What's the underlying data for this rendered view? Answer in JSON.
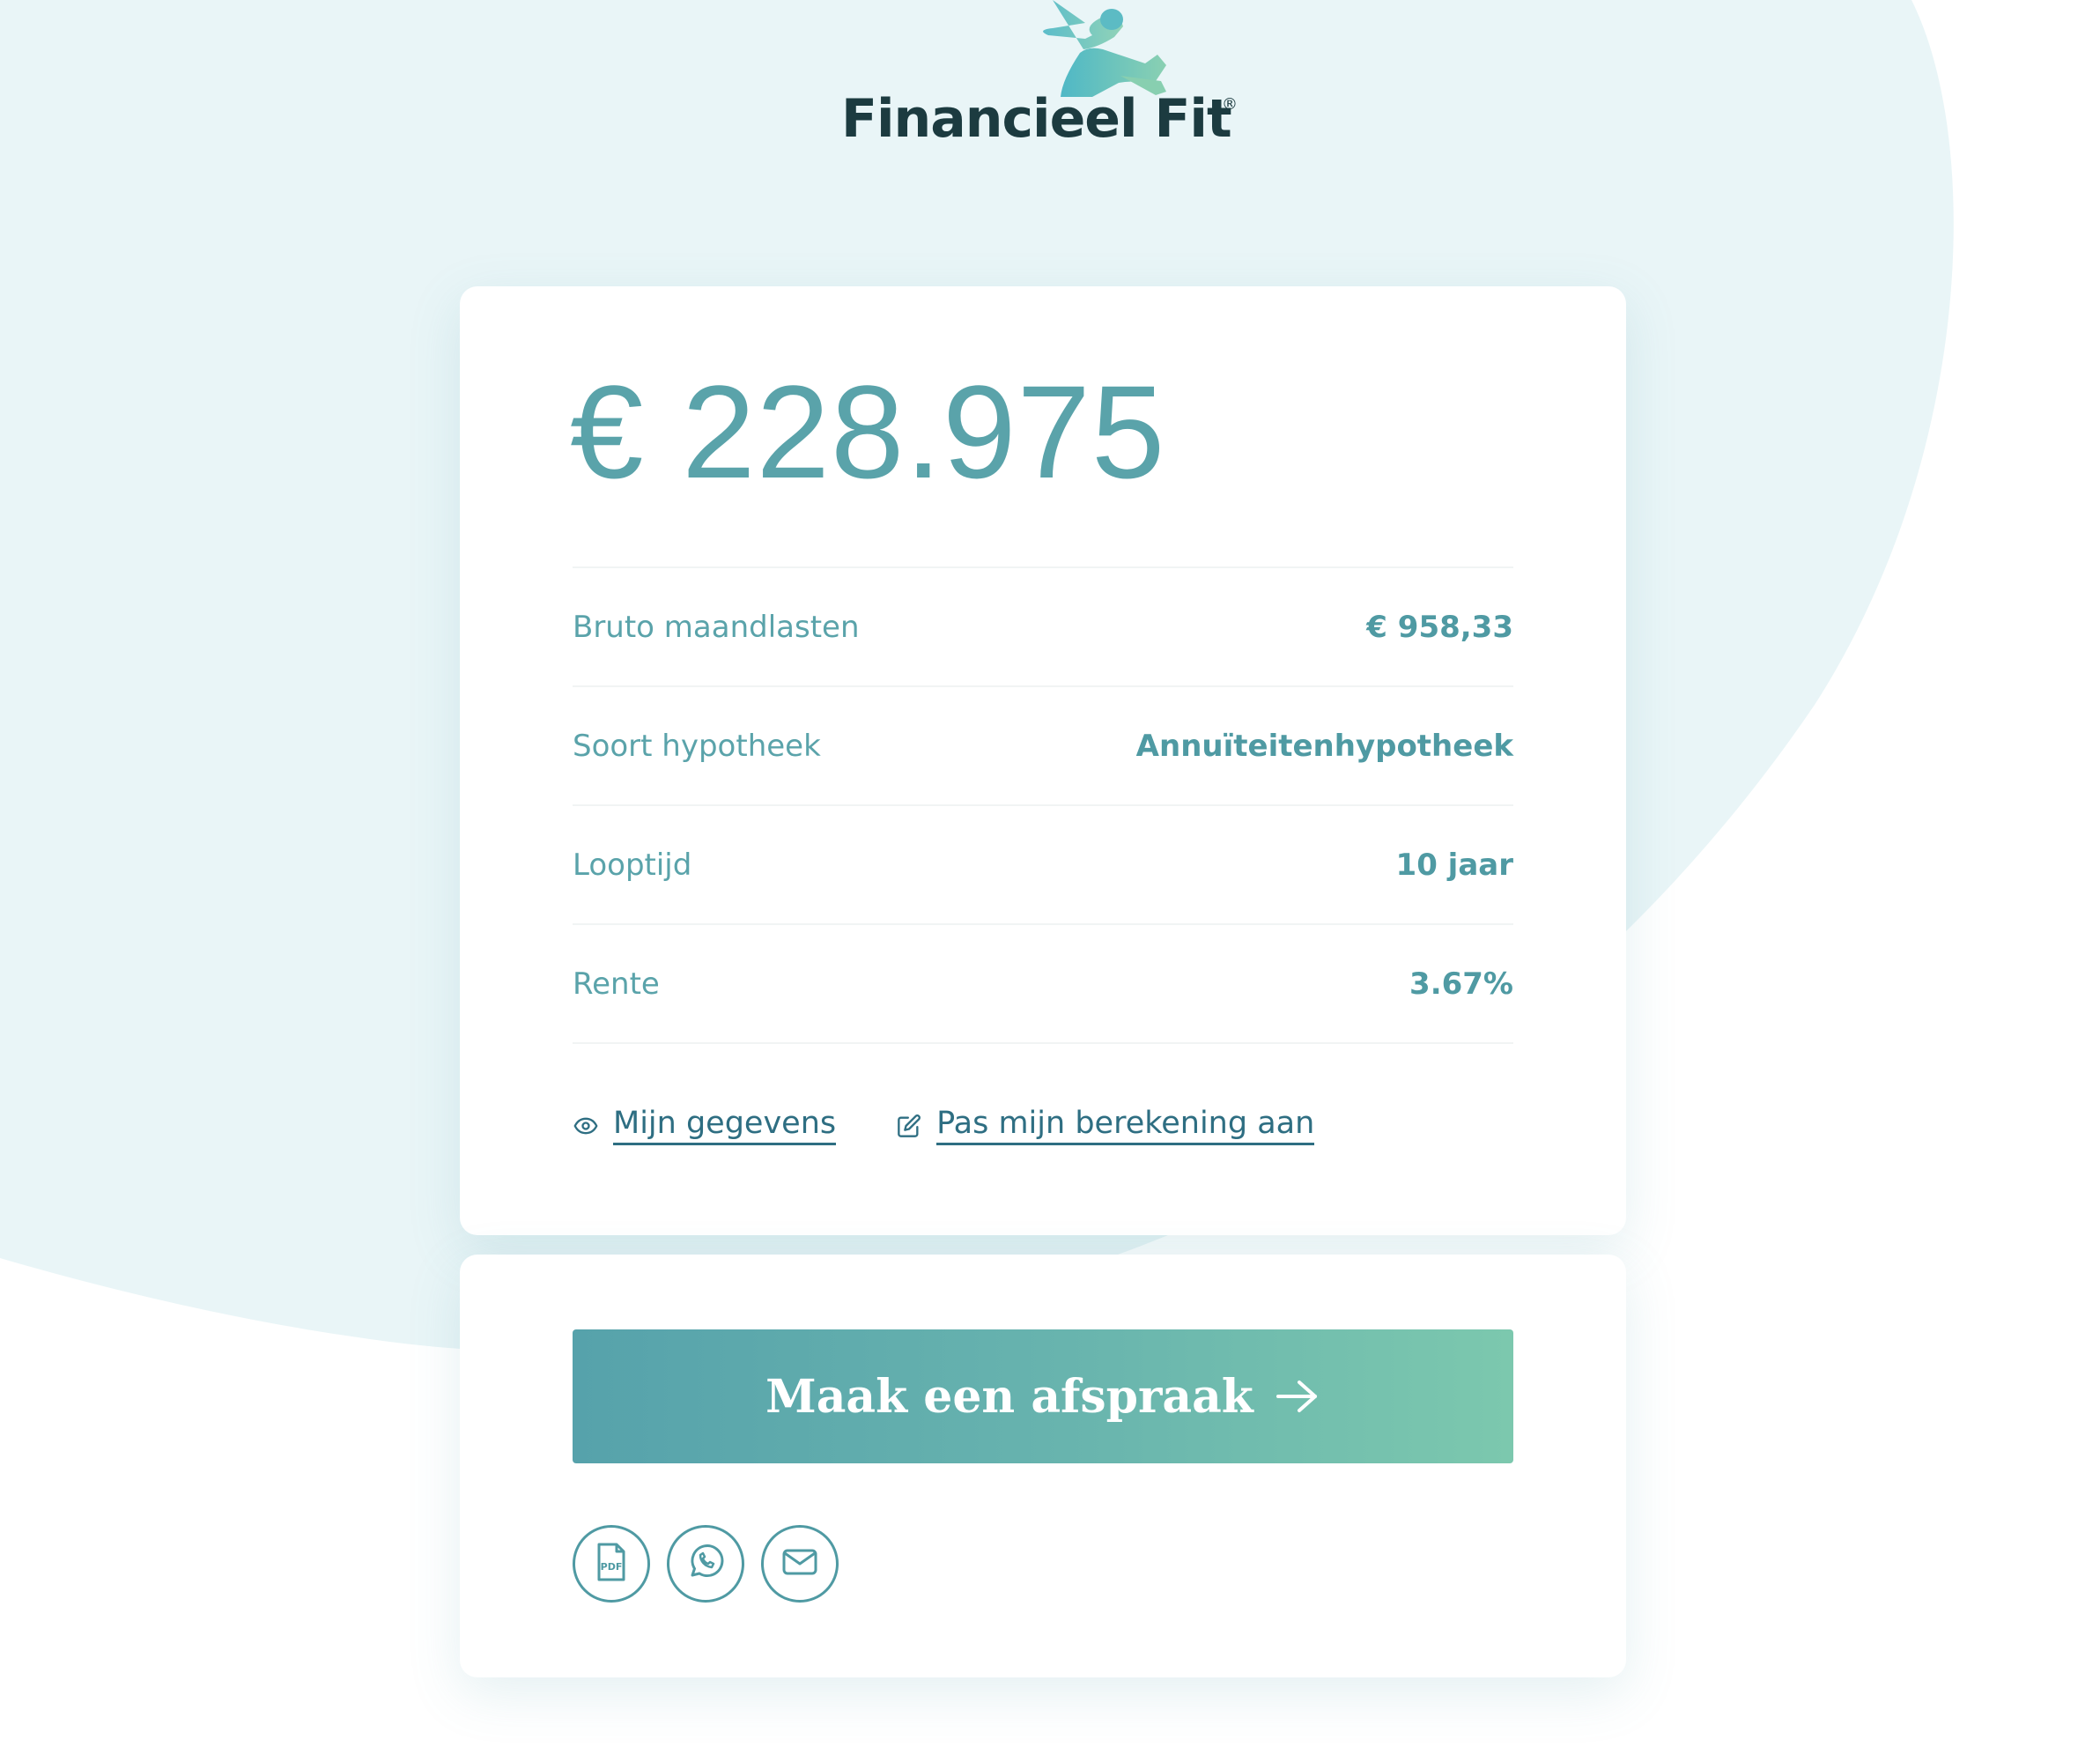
{
  "brand": {
    "name": "Financieel Fit",
    "registered_mark": "®"
  },
  "result": {
    "amount": "€ 228.975"
  },
  "details": [
    {
      "label": "Bruto maandlasten",
      "value": "€ 958,33"
    },
    {
      "label": "Soort hypotheek",
      "value": "Annuïteitenhypotheek"
    },
    {
      "label": "Looptijd",
      "value": "10 jaar"
    },
    {
      "label": "Rente",
      "value": "3.67%"
    }
  ],
  "links": {
    "my_details": "Mijn gegevens",
    "edit_calculation": "Pas mijn berekening aan"
  },
  "cta": {
    "label": "Maak een afspraak"
  },
  "share": {
    "icons": [
      "pdf-icon",
      "whatsapp-icon",
      "mail-icon"
    ]
  },
  "colors": {
    "accent": "#5aa3aa",
    "link": "#2e6e82",
    "brand_dark": "#1c3b40",
    "background_blob": "#e9f5f7",
    "cta_gradient_start": "#56a2ab",
    "cta_gradient_end": "#7cc8ae"
  }
}
